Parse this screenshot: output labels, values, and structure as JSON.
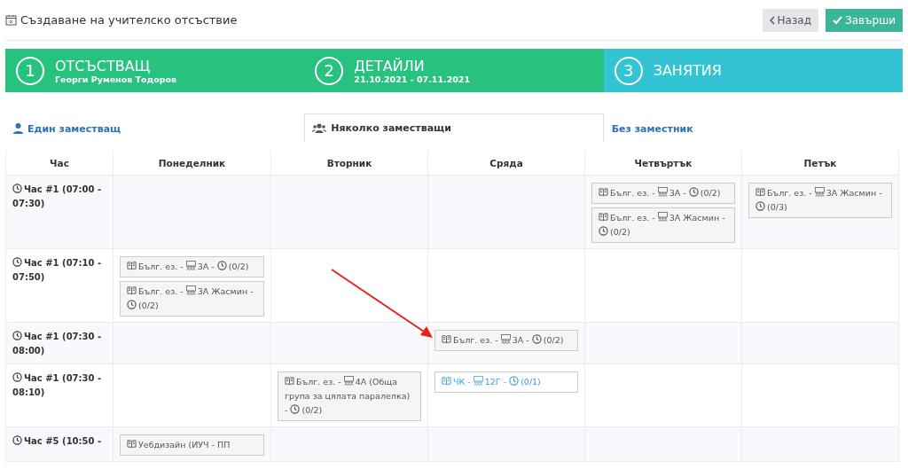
{
  "page": {
    "title": "Създаване на учителско отсъствие"
  },
  "buttons": [
    {
      "label": "Назад",
      "kind": "back"
    },
    {
      "label": "Завърши",
      "kind": "finish"
    }
  ],
  "steps": [
    {
      "number": "1",
      "title": "ОТСЪСТВАЩ",
      "subtitle": "Георги Руменов Тодоров",
      "selected": false
    },
    {
      "number": "2",
      "title": "ДЕТАЙЛИ",
      "subtitle": "21.10.2021 - 07.11.2021",
      "selected": false
    },
    {
      "number": "3",
      "title": "ЗАНЯТИЯ",
      "selected": true
    }
  ],
  "tabs": [
    {
      "label": "Един заместващ",
      "selected": false
    },
    {
      "label": "Няколко заместващи",
      "selected": true
    },
    {
      "label": "Без заместник",
      "selected": false
    }
  ],
  "table": {
    "period_header": "Час",
    "columns": [
      "Понеделник",
      "Вторник",
      "Сряда",
      "Четвъртък",
      "Петък"
    ],
    "rows": [
      {
        "period": "Час #1 (07:00 - 07:30)",
        "cells": [
          [],
          [],
          [],
          [
            {
              "subject": "Бълг. ез. -",
              "class": "3А -",
              "count": "(0/2)",
              "kind": "taken"
            },
            {
              "subject": "Бълг. ез. -",
              "class": "3А Жасмин -",
              "count": "(0/2)",
              "kind": "taken"
            }
          ],
          [
            {
              "subject": "Бълг. ез. -",
              "class": "3А Жасмин -",
              "count": "(0/3)",
              "kind": "taken"
            }
          ]
        ]
      },
      {
        "period": "Час #1 (07:10 - 07:50)",
        "cells": [
          [
            {
              "subject": "Бълг. ез. -",
              "class": "3А -",
              "count": "(0/2)",
              "kind": "taken"
            },
            {
              "subject": "Бълг. ез. -",
              "class": "3А Жасмин -",
              "count": "(0/2)",
              "kind": "taken"
            }
          ],
          [],
          [],
          [],
          []
        ]
      },
      {
        "period": "Час #1 (07:30 - 08:00)",
        "cells": [
          [],
          [],
          [
            {
              "subject": "Бълг. ез. -",
              "class": "3А -",
              "count": "(0/2)",
              "kind": "taken"
            }
          ],
          [],
          []
        ]
      },
      {
        "period": "Час #1 (07:30 - 08:10)",
        "cells": [
          [],
          [
            {
              "subject": "Бълг. ез. -",
              "class": "4А (Обща група за цялата паралелка) -",
              "count": "(0/2)",
              "kind": "taken"
            }
          ],
          [
            {
              "subject": "ЧК -",
              "class": "12Г -",
              "count": "(0/1)",
              "kind": "open"
            }
          ],
          [],
          []
        ]
      },
      {
        "period": "Час #5 (10:50 -",
        "cells": [
          [
            {
              "subject": "Уебдизайн (ИУЧ - ПП",
              "kind": "taken"
            }
          ],
          [],
          [],
          [],
          []
        ]
      }
    ]
  }
}
